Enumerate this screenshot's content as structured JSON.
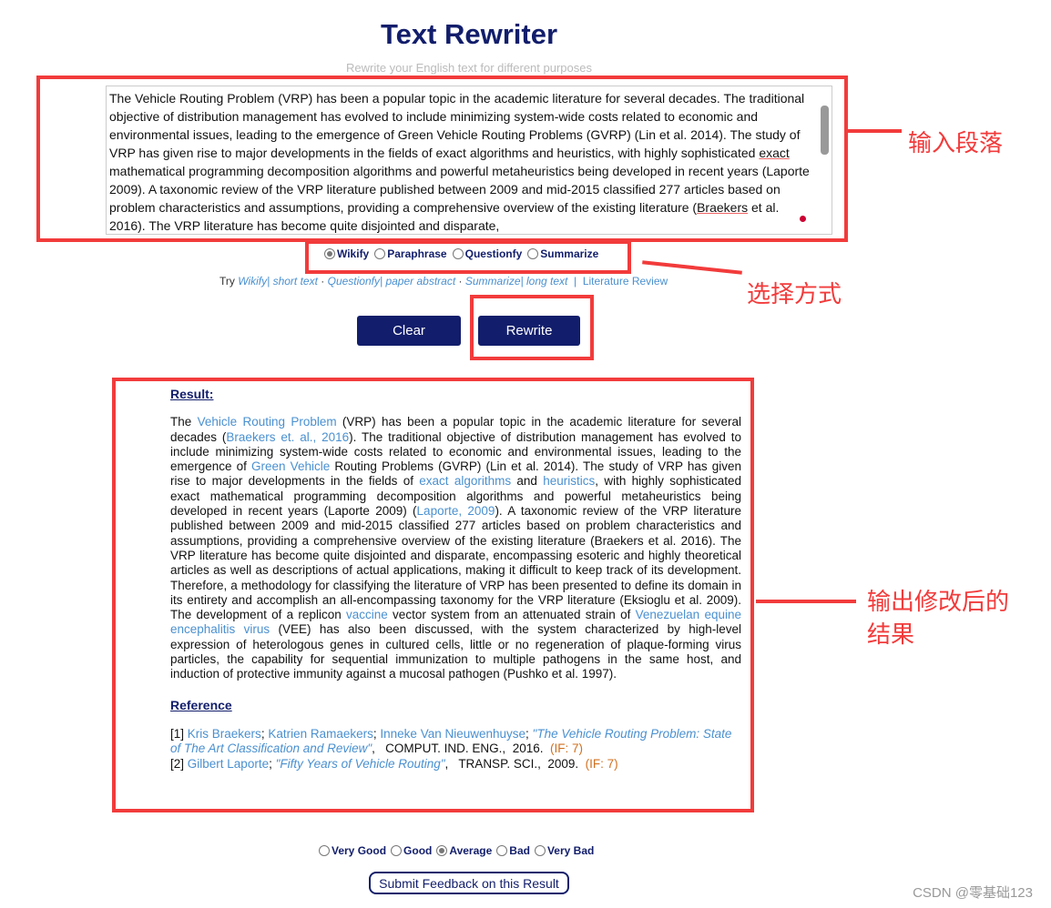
{
  "header": {
    "title": "Text Rewriter",
    "subtitle": "Rewrite your English text for different purposes"
  },
  "input": {
    "text_parts": [
      "The Vehicle Routing Problem (VRP) has been a popular topic in the academic literature for several decades. The traditional objective of distribution management has evolved to include minimizing system-wide costs related to economic and environmental issues, leading to the emergence of Green Vehicle Routing Problems (GVRP) (Lin et al. 2014). The study of VRP has given rise to major developments in the fields of exact algorithms and heuristics, with highly sophisticated ",
      "exact",
      " mathematical programming decomposition algorithms and powerful metaheuristics being developed in recent years (Laporte 2009). A taxonomic review of the VRP literature published between 2009 and mid-2015 classified 277 articles based on problem characteristics and assumptions, providing a comprehensive overview of the existing literature (",
      "Braekers",
      " et al. 2016). The VRP literature has become quite disjointed and disparate,"
    ]
  },
  "modes": [
    {
      "label": "Wikify",
      "selected": true
    },
    {
      "label": "Paraphrase",
      "selected": false
    },
    {
      "label": "Questionfy",
      "selected": false
    },
    {
      "label": "Summarize",
      "selected": false
    }
  ],
  "try": {
    "prefix": "Try",
    "links": [
      "Wikify| short text",
      "Questionfy| paper abstract",
      "Summarize| long text"
    ],
    "sep": "·",
    "bar": "|",
    "lit": "Literature Review"
  },
  "buttons": {
    "clear": "Clear",
    "rewrite": "Rewrite"
  },
  "result": {
    "heading": "Result:",
    "segments": [
      {
        "t": "The "
      },
      {
        "t": "Vehicle Routing Problem",
        "link": true
      },
      {
        "t": " (VRP) has been a popular topic in the academic literature for several decades ("
      },
      {
        "t": "Braekers et. al., 2016",
        "link": true
      },
      {
        "t": "). The traditional objective of distribution management has evolved to include minimizing system-wide costs related to economic and environmental issues, leading to the emergence of "
      },
      {
        "t": "Green Vehicle",
        "link": true
      },
      {
        "t": " Routing Problems (GVRP) (Lin et al. 2014). The study of VRP has given rise to major developments in the fields of "
      },
      {
        "t": "exact algorithms",
        "link": true
      },
      {
        "t": " and "
      },
      {
        "t": "heuristics",
        "link": true
      },
      {
        "t": ", with highly sophisticated exact mathematical programming decomposition algorithms and powerful metaheuristics being developed in recent years (Laporte 2009) ("
      },
      {
        "t": "Laporte, 2009",
        "link": true
      },
      {
        "t": "). A taxonomic review of the VRP literature published between 2009 and mid-2015 classified 277 articles based on problem characteristics and assumptions, providing a comprehensive overview of the existing literature (Braekers et al. 2016). The VRP literature has become quite disjointed and disparate, encompassing esoteric and highly theoretical articles as well as descriptions of actual applications, making it difficult to keep track of its development. Therefore, a methodology for classifying the literature of VRP has been presented to define its domain in its entirety and accomplish an all-encompassing taxonomy for the VRP literature (Eksioglu et al. 2009). The development of a replicon "
      },
      {
        "t": "vaccine",
        "link": true
      },
      {
        "t": " vector system from an attenuated strain of "
      },
      {
        "t": "Venezuelan equine encephalitis virus",
        "link": true
      },
      {
        "t": " (VEE) has also been discussed, with the system characterized by high-level expression of heterologous genes in cultured cells, little or no regeneration of plaque-forming virus particles, the capability for sequential immunization to multiple pathogens in the same host, and induction of protective immunity against a mucosal pathogen (Pushko et al. 1997)."
      }
    ]
  },
  "reference": {
    "heading": "Reference",
    "items": [
      {
        "num": "[1]",
        "authors": [
          "Kris Braekers",
          "Katrien Ramaekers",
          "Inneke Van Nieuwenhuyse"
        ],
        "title": "\"The Vehicle Routing Problem: State of The Art Classification and Review\"",
        "journal": "COMPUT. IND. ENG.,",
        "year": "2016.",
        "if": "(IF: 7)"
      },
      {
        "num": "[2]",
        "authors": [
          "Gilbert Laporte"
        ],
        "title": "\"Fifty Years of Vehicle Routing\"",
        "journal": "TRANSP. SCI.,",
        "year": "2009.",
        "if": "(IF: 7)"
      }
    ]
  },
  "feedback": {
    "options": [
      {
        "label": "Very Good",
        "selected": false
      },
      {
        "label": "Good",
        "selected": false
      },
      {
        "label": "Average",
        "selected": true
      },
      {
        "label": "Bad",
        "selected": false
      },
      {
        "label": "Very Bad",
        "selected": false
      }
    ],
    "submit": "Submit Feedback on this Result"
  },
  "annotations": {
    "input": "输入段落",
    "mode": "选择方式",
    "output_line1": "输出修改后的",
    "output_line2": "结果",
    "color": "#f23b3b"
  },
  "watermark": "CSDN @零基础123"
}
